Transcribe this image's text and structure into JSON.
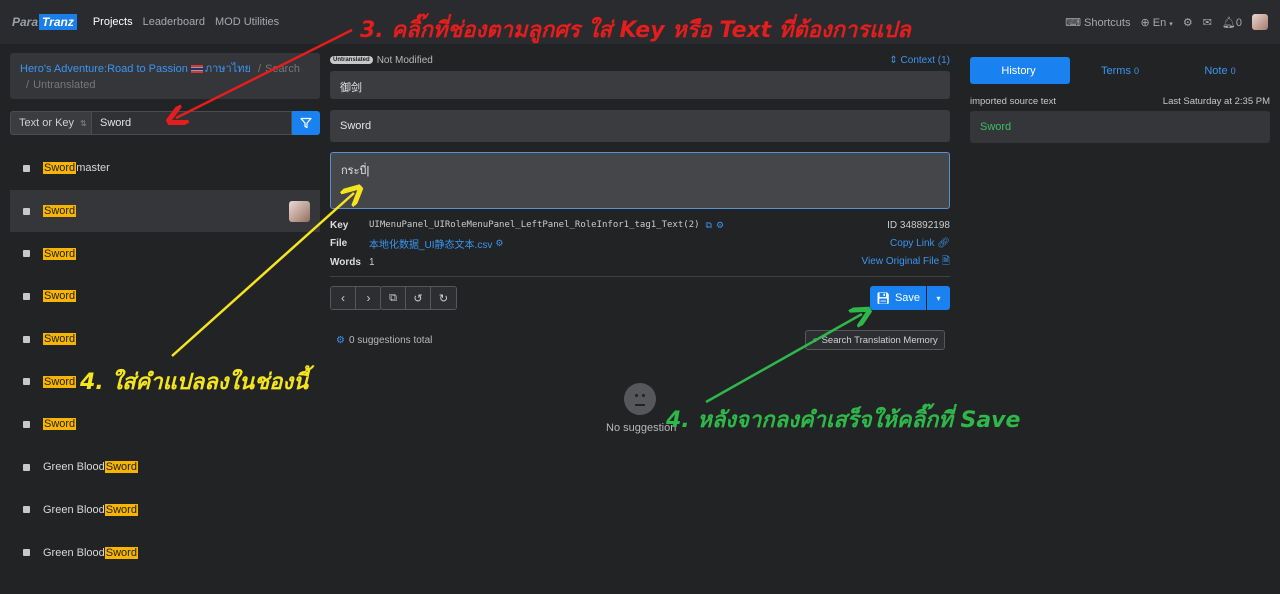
{
  "nav": {
    "logo_part1": "Para",
    "logo_part2": "Tranz",
    "items": [
      "Projects",
      "Leaderboard",
      "MOD Utilities"
    ],
    "shortcuts": "Shortcuts",
    "language": "En",
    "notifications": "0"
  },
  "breadcrumb": {
    "project": "Hero's Adventure:Road to Passion",
    "language": "ภาษาไทย",
    "search": "Search",
    "filter": "Untranslated"
  },
  "search": {
    "mode": "Text or Key",
    "query": "Sword"
  },
  "list": [
    {
      "highlight": "Sword",
      "suffix": " master",
      "prefix": ""
    },
    {
      "highlight": "Sword",
      "suffix": "",
      "prefix": ""
    },
    {
      "highlight": "Sword",
      "suffix": "",
      "prefix": ""
    },
    {
      "highlight": "Sword",
      "suffix": "",
      "prefix": ""
    },
    {
      "highlight": "Sword",
      "suffix": "",
      "prefix": ""
    },
    {
      "highlight": "Sword",
      "suffix": "",
      "prefix": ""
    },
    {
      "highlight": "Sword",
      "suffix": "",
      "prefix": ""
    },
    {
      "highlight": "Sword",
      "suffix": "",
      "prefix": "Green Blood "
    },
    {
      "highlight": "Sword",
      "suffix": "",
      "prefix": "Green Blood "
    },
    {
      "highlight": "Sword",
      "suffix": "",
      "prefix": "Green Blood "
    }
  ],
  "editor": {
    "badge": "Untranslated",
    "status": "Not Modified",
    "context": "Context (1)",
    "key_text": "御剑",
    "original": "Sword",
    "translation": "กระบี่",
    "key_label": "Key",
    "key_value": "UIMenuPanel_UIRoleMenuPanel_LeftPanel_RoleInfor1_tag1_Text(2)",
    "id": "ID 348892198",
    "file_label": "File",
    "file_value": "本地化数据_UI静态文本.csv",
    "copy_link": "Copy Link",
    "words_label": "Words",
    "words_value": "1",
    "view_original": "View Original File",
    "save": "Save",
    "suggestions_total": "0 suggestions total",
    "search_tm": "Search Translation Memory",
    "no_suggestion": "No suggestion"
  },
  "right": {
    "tabs": [
      {
        "label": "History",
        "count": ""
      },
      {
        "label": "Terms",
        "count": "0"
      },
      {
        "label": "Note",
        "count": "0"
      }
    ],
    "history_label": "imported source text",
    "history_time": "Last Saturday at 2:35 PM",
    "history_value": "Sword"
  },
  "annotations": {
    "step3": "3. คลิ๊กที่ช่องตามลูกศร ใส่ Key หรือ  Text ที่ต้องการแปล",
    "step4a": "4. ใส่คำแปลลงในช่องนี้",
    "step4b": "4. หลังจากลงคำเสร็จให้คลิ๊กที่ Save"
  },
  "colors": {
    "accent": "#1a82f0",
    "highlight": "#f7b500",
    "annotation_red": "#e41d1d",
    "annotation_yellow": "#f5e51f",
    "annotation_green": "#2fb84a"
  }
}
